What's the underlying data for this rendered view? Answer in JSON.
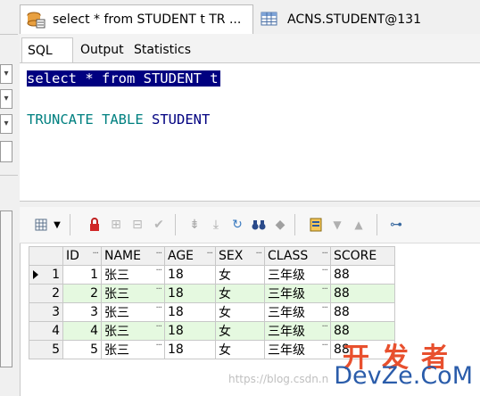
{
  "tabs": {
    "active": "select * from STUDENT t TR ...",
    "inactive": "ACNS.STUDENT@131"
  },
  "subtabs": [
    "SQL",
    "Output",
    "Statistics"
  ],
  "editor": {
    "line1": "select * from STUDENT t",
    "line3_kw1": "TRUNCATE",
    "line3_kw2": "TABLE",
    "line3_id": "STUDENT"
  },
  "grid": {
    "columns": [
      "ID",
      "NAME",
      "AGE",
      "SEX",
      "CLASS",
      "SCORE"
    ],
    "rows": [
      {
        "num": "1",
        "id": "1",
        "name": "张三",
        "age": "18",
        "sex": "女",
        "class": "三年级",
        "score": "88"
      },
      {
        "num": "2",
        "id": "2",
        "name": "张三",
        "age": "18",
        "sex": "女",
        "class": "三年级",
        "score": "88"
      },
      {
        "num": "3",
        "id": "3",
        "name": "张三",
        "age": "18",
        "sex": "女",
        "class": "三年级",
        "score": "88"
      },
      {
        "num": "4",
        "id": "4",
        "name": "张三",
        "age": "18",
        "sex": "女",
        "class": "三年级",
        "score": "88"
      },
      {
        "num": "5",
        "id": "5",
        "name": "张三",
        "age": "18",
        "sex": "女",
        "class": "三年级",
        "score": "88"
      }
    ],
    "cell_dots": "···"
  },
  "watermark": "https://blog.csdn.n",
  "logo": {
    "top": "开发者",
    "bottom": "DevZe.CoM"
  }
}
